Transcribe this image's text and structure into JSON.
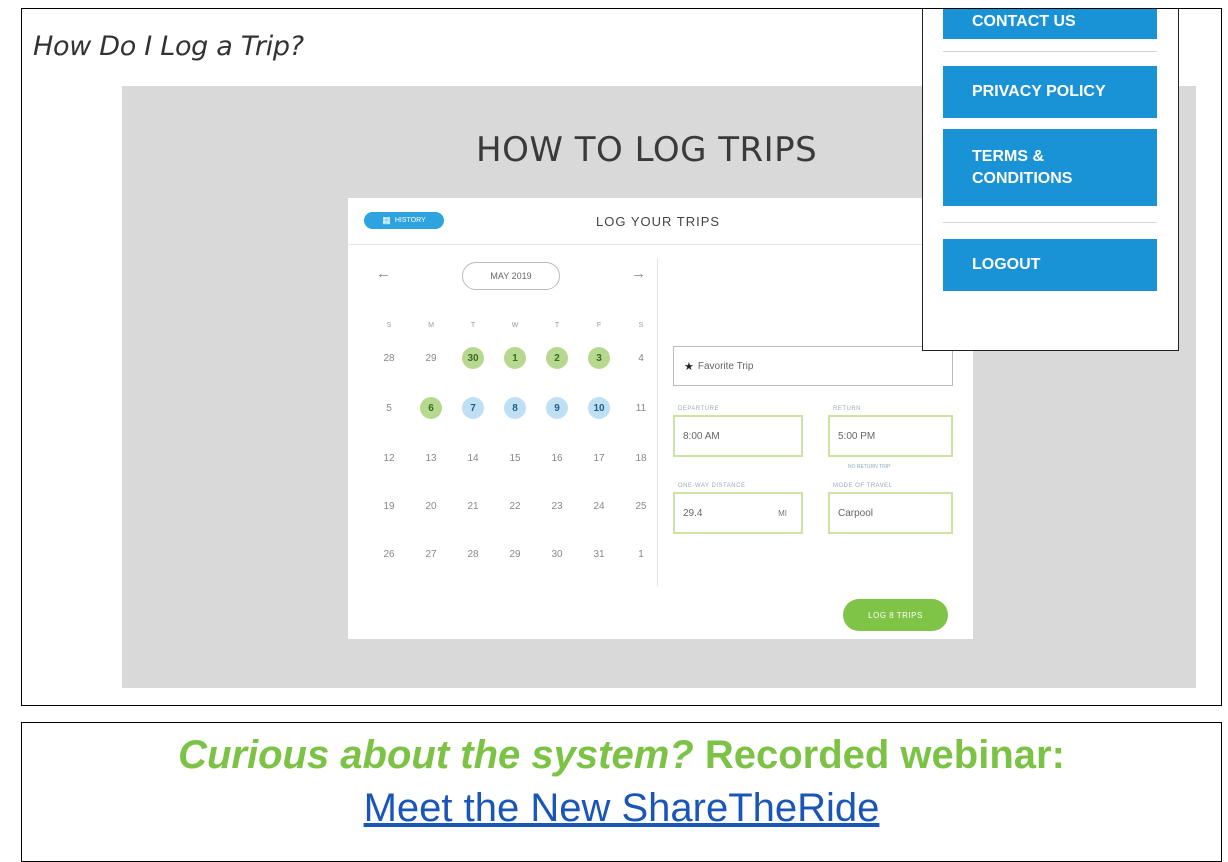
{
  "frame": {
    "title": "How Do I Log a Trip?"
  },
  "panel": {
    "heading": "HOW TO LOG TRIPS"
  },
  "app": {
    "history_label": "HISTORY",
    "title": "LOG YOUR TRIPS",
    "month": "MAY 2019",
    "prev_arrow": "←",
    "next_arrow": "→",
    "dow": [
      "S",
      "M",
      "T",
      "W",
      "T",
      "F",
      "S"
    ],
    "weeks": [
      [
        {
          "d": "28"
        },
        {
          "d": "29"
        },
        {
          "d": "30",
          "s": "green"
        },
        {
          "d": "1",
          "s": "green"
        },
        {
          "d": "2",
          "s": "green"
        },
        {
          "d": "3",
          "s": "green"
        },
        {
          "d": "4"
        }
      ],
      [
        {
          "d": "5"
        },
        {
          "d": "6",
          "s": "green"
        },
        {
          "d": "7",
          "s": "blue"
        },
        {
          "d": "8",
          "s": "blue"
        },
        {
          "d": "9",
          "s": "blue"
        },
        {
          "d": "10",
          "s": "blue"
        },
        {
          "d": "11"
        }
      ],
      [
        {
          "d": "12"
        },
        {
          "d": "13"
        },
        {
          "d": "14"
        },
        {
          "d": "15"
        },
        {
          "d": "16"
        },
        {
          "d": "17"
        },
        {
          "d": "18"
        }
      ],
      [
        {
          "d": "19"
        },
        {
          "d": "20"
        },
        {
          "d": "21"
        },
        {
          "d": "22"
        },
        {
          "d": "23"
        },
        {
          "d": "24"
        },
        {
          "d": "25"
        }
      ],
      [
        {
          "d": "26"
        },
        {
          "d": "27"
        },
        {
          "d": "28"
        },
        {
          "d": "29"
        },
        {
          "d": "30"
        },
        {
          "d": "31"
        },
        {
          "d": "1"
        }
      ]
    ],
    "favorite_trip": "Favorite Trip",
    "departure_label": "DEPARTURE",
    "departure_value": "8:00 AM",
    "return_label": "RETURN",
    "return_value": "5:00 PM",
    "no_return_note": "NO RETURN TRIP",
    "distance_label": "ONE-WAY DISTANCE",
    "distance_value": "29.4",
    "distance_unit": "MI",
    "mode_label": "MODE OF TRAVEL",
    "mode_value": "Carpool",
    "log_button": "LOG 8 TRIPS"
  },
  "menu": {
    "contact": "CONTACT US",
    "privacy": "PRIVACY POLICY",
    "terms_line1": "TERMS &",
    "terms_line2": "CONDITIONS",
    "logout": "LOGOUT"
  },
  "promo": {
    "question": "Curious about the system?",
    "recorded": "Recorded webinar:",
    "link": "Meet the New ShareTheRide"
  },
  "colors": {
    "menu_blue": "#1a92d6",
    "promo_green": "#7cc245",
    "link_blue": "#1a55b8",
    "pill_blue": "#2ea3e0",
    "day_green": "#b6d98f",
    "day_blue": "#bfdff3",
    "button_green": "#7fc347"
  },
  "icons": {
    "calendar": "calendar-icon",
    "star": "star-icon",
    "arrow_left": "arrow-left-icon",
    "arrow_right": "arrow-right-icon"
  }
}
